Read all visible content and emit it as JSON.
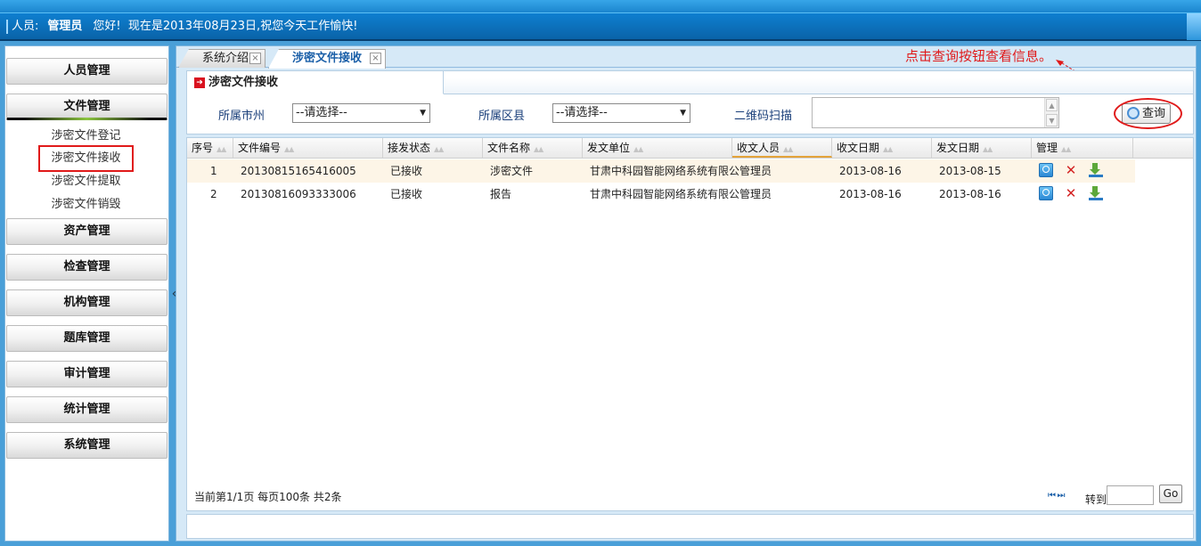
{
  "header": {
    "user_label": "人员:",
    "user_name": "管理员",
    "greeting": "您好!",
    "date_message": "现在是2013年08月23日,祝您今天工作愉快!"
  },
  "sidebar": {
    "menus": [
      {
        "label": "人员管理"
      },
      {
        "label": "文件管理"
      },
      {
        "label": "资产管理"
      },
      {
        "label": "检查管理"
      },
      {
        "label": "机构管理"
      },
      {
        "label": "题库管理"
      },
      {
        "label": "审计管理"
      },
      {
        "label": "统计管理"
      },
      {
        "label": "系统管理"
      }
    ],
    "file_sub_items": [
      {
        "label": "涉密文件登记"
      },
      {
        "label": "涉密文件接收"
      },
      {
        "label": "涉密文件提取"
      },
      {
        "label": "涉密文件销毁"
      }
    ],
    "collapse_glyph": "«"
  },
  "tabs": [
    {
      "label": "系统介绍",
      "close": "×"
    },
    {
      "label": "涉密文件接收",
      "close": "×"
    }
  ],
  "annotation": "点击查询按钮查看信息。",
  "section": {
    "title": "涉密文件接收",
    "city_label": "所属市州",
    "city_value": "--请选择--",
    "district_label": "所属区县",
    "district_value": "--请选择--",
    "qr_label": "二维码扫描",
    "query_button": "查询"
  },
  "grid": {
    "columns": [
      "序号",
      "文件编号",
      "接发状态",
      "文件名称",
      "发文单位",
      "收文人员",
      "收文日期",
      "发文日期",
      "管理"
    ],
    "rows": [
      {
        "no": "1",
        "code": "20130815165416005",
        "status": "已接收",
        "name": "涉密文件",
        "unit": "甘肃中科园智能网络系统有限公",
        "receiver": "管理员",
        "recv_date": "2013-08-16",
        "send_date": "2013-08-15"
      },
      {
        "no": "2",
        "code": "20130816093333006",
        "status": "已接收",
        "name": "报告",
        "unit": "甘肃中科园智能网络系统有限公",
        "receiver": "管理员",
        "recv_date": "2013-08-16",
        "send_date": "2013-08-16"
      }
    ],
    "sort_glyph": "▲▲",
    "pager_text": "当前第1/1页 每页100条 共2条",
    "nav_first": "⏮",
    "nav_last": "⏭",
    "goto_label": "转到",
    "goto_button": "Go"
  },
  "colors": {
    "accent": "#1a5fa8",
    "highlight_red": "#e01a1a",
    "row_alt": "#fdf5e7",
    "topbar": "#0e6fb8"
  }
}
